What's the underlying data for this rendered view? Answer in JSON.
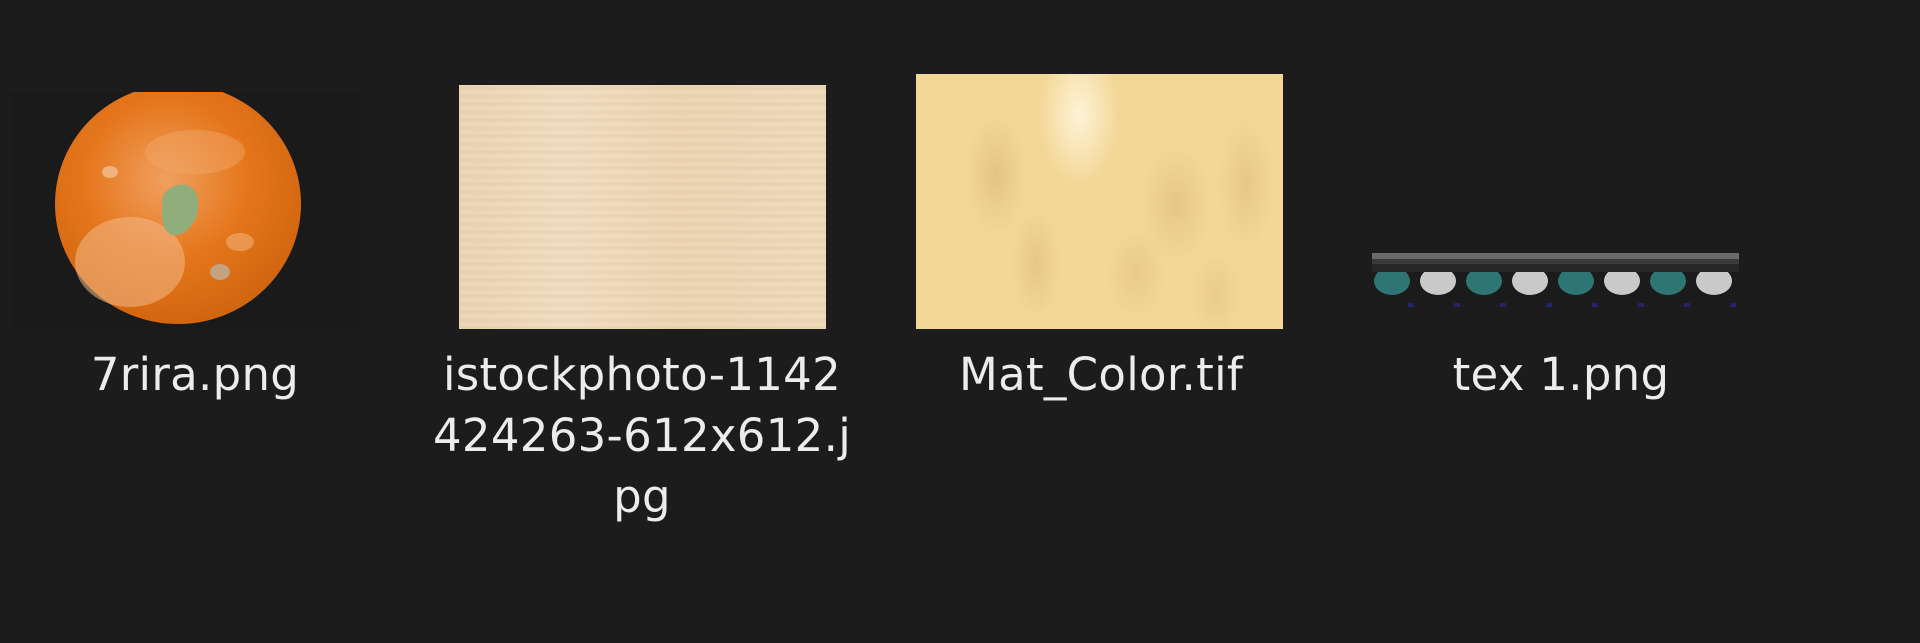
{
  "files": [
    {
      "name_lines": [
        "7rira.png"
      ],
      "thumbnail": "orange-texture-thumbnail"
    },
    {
      "name_lines": [
        "istockphoto-1142",
        "424263-612x612.j",
        "pg"
      ],
      "thumbnail": "light-wood-texture-thumbnail"
    },
    {
      "name_lines": [
        "Mat_Color.tif"
      ],
      "thumbnail": "pale-yellow-material-thumbnail"
    },
    {
      "name_lines": [
        "tex 1.png"
      ],
      "thumbnail": "shelf-balls-texture-thumbnail"
    }
  ],
  "colors": {
    "background": "#1c1c1c",
    "text": "#ececec",
    "orange": "#e5761c",
    "wood": "#efdabd",
    "mat": "#f3d797",
    "teal": "#2e7573",
    "grey_ball": "#c9c9c9"
  }
}
